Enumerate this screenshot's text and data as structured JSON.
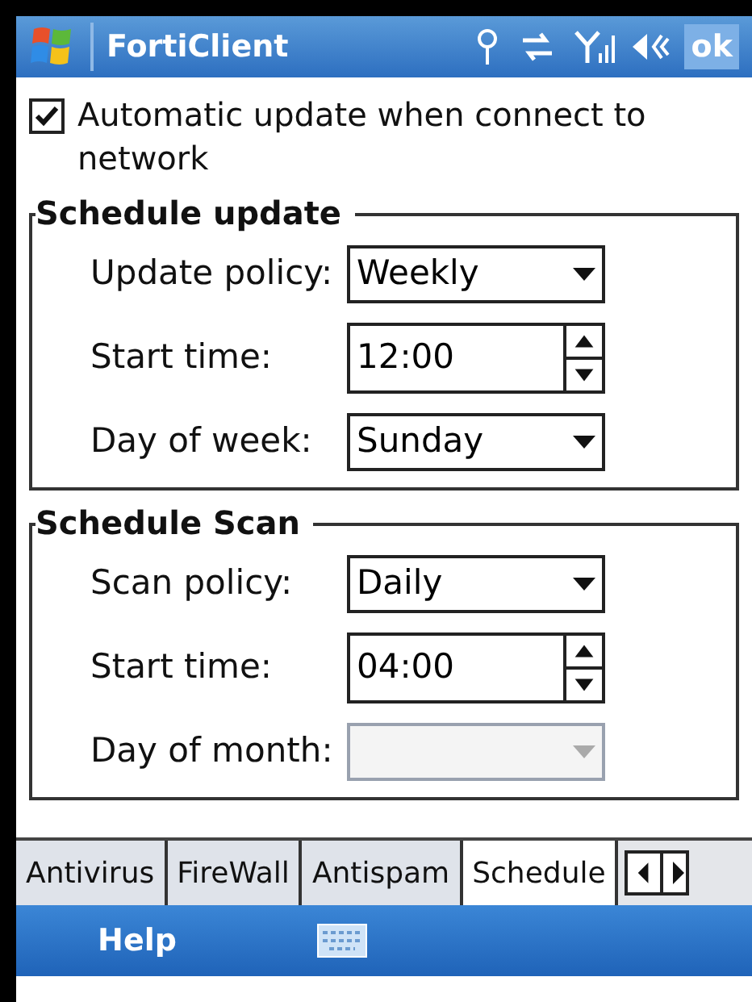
{
  "title_bar": {
    "title": "FortiClient",
    "ok": "ok"
  },
  "auto_update": {
    "label": "Automatic update when connect to network",
    "checked": true
  },
  "groups": [
    {
      "title": "Schedule update",
      "fields": [
        {
          "label": "Update policy:",
          "kind": "dropdown",
          "value": "Weekly",
          "disabled": false
        },
        {
          "label": "Start time:",
          "kind": "spinner",
          "value": "12:00",
          "disabled": false
        },
        {
          "label": "Day of week:",
          "kind": "dropdown",
          "value": "Sunday",
          "disabled": false
        }
      ]
    },
    {
      "title": "Schedule Scan",
      "fields": [
        {
          "label": "Scan policy:",
          "kind": "dropdown",
          "value": "Daily",
          "disabled": false
        },
        {
          "label": "Start time:",
          "kind": "spinner",
          "value": "04:00",
          "disabled": false
        },
        {
          "label": "Day of month:",
          "kind": "dropdown",
          "disabled": true
        }
      ]
    }
  ],
  "tabs": [
    {
      "label": "Antivirus",
      "selected": false
    },
    {
      "label": "FireWall",
      "selected": false
    },
    {
      "label": "Antispam",
      "selected": false
    },
    {
      "label": "Schedule",
      "selected": true
    }
  ],
  "menu_bar": {
    "left": "Help"
  }
}
